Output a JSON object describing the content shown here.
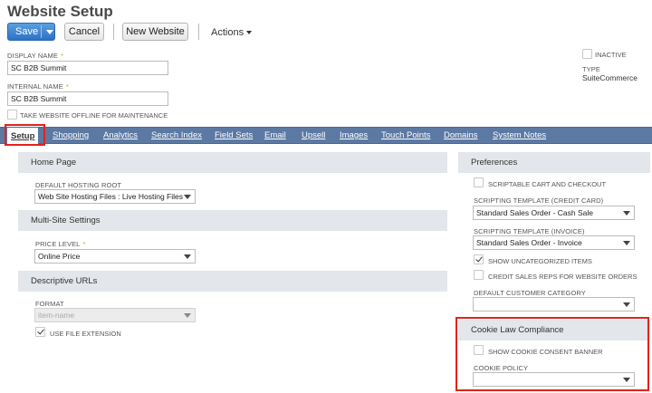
{
  "page": {
    "title": "Website Setup"
  },
  "toolbar": {
    "save_label": "Save",
    "cancel_label": "Cancel",
    "new_website_label": "New Website",
    "actions_label": "Actions"
  },
  "header": {
    "display_name": {
      "label": "DISPLAY NAME",
      "value": "SC B2B Summit"
    },
    "internal_name": {
      "label": "INTERNAL NAME",
      "value": "SC B2B Summit"
    },
    "offline_label": "TAKE WEBSITE OFFLINE FOR MAINTENANCE",
    "offline_checked": false,
    "inactive_label": "INACTIVE",
    "inactive_checked": false,
    "type_label": "TYPE",
    "type_value": "SuiteCommerce"
  },
  "tabs": [
    {
      "label": "Setup",
      "active": true
    },
    {
      "label": "Shopping"
    },
    {
      "label": "Analytics"
    },
    {
      "label": "Search Index"
    },
    {
      "label": "Field Sets"
    },
    {
      "label": "Email"
    },
    {
      "label": "Upsell"
    },
    {
      "label": "Images"
    },
    {
      "label": "Touch Points"
    },
    {
      "label": "Domains"
    },
    {
      "label": "System Notes"
    }
  ],
  "left": {
    "home_page": {
      "title": "Home Page",
      "hosting_root_label": "DEFAULT HOSTING ROOT",
      "hosting_root_value": "Web Site Hosting Files : Live Hosting Files"
    },
    "multi_site": {
      "title": "Multi-Site Settings",
      "price_level_label": "PRICE LEVEL",
      "price_level_value": "Online Price"
    },
    "descriptive_urls": {
      "title": "Descriptive URLs",
      "format_label": "FORMAT",
      "format_value": "item-name",
      "file_ext_label": "USE FILE EXTENSION",
      "file_ext_checked": true
    }
  },
  "right": {
    "preferences": {
      "title": "Preferences",
      "scriptable_cart_label": "SCRIPTABLE CART AND CHECKOUT",
      "script_cc_label": "SCRIPTING TEMPLATE (CREDIT CARD)",
      "script_cc_value": "Standard Sales Order - Cash Sale",
      "script_inv_label": "SCRIPTING TEMPLATE (INVOICE)",
      "script_inv_value": "Standard Sales Order - Invoice",
      "show_uncat_label": "SHOW UNCATEGORIZED ITEMS",
      "show_uncat_checked": true,
      "credit_reps_label": "CREDIT SALES REPS FOR WEBSITE ORDERS",
      "default_cat_label": "DEFAULT CUSTOMER CATEGORY",
      "default_cat_value": ""
    },
    "cookie": {
      "title": "Cookie Law Compliance",
      "consent_label": "SHOW COOKIE CONSENT BANNER",
      "policy_label": "COOKIE POLICY",
      "policy_value": ""
    }
  },
  "colors": {
    "tabbar": "#5b79a3",
    "highlight": "#e2231a",
    "save_button": "#2d72c4"
  }
}
